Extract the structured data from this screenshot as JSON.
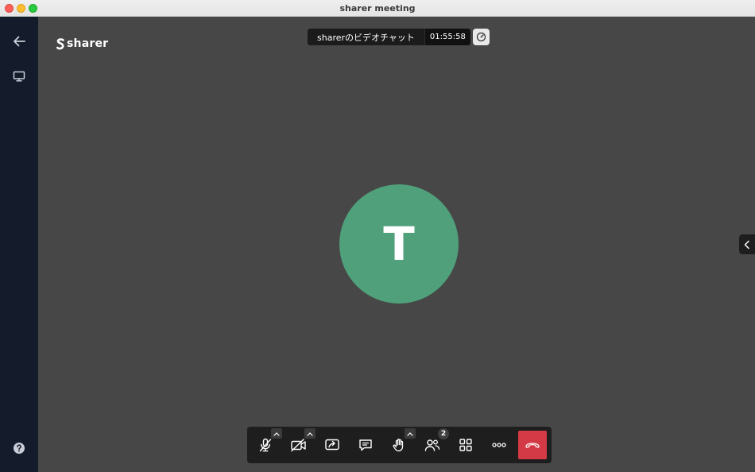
{
  "window": {
    "title": "sharer meeting"
  },
  "sidebar": {
    "items": [
      {
        "name": "back",
        "icon": "arrow-left-icon"
      },
      {
        "name": "screen",
        "icon": "monitor-icon"
      },
      {
        "name": "help",
        "icon": "help-circle-icon"
      }
    ]
  },
  "brand": {
    "logo_text": "sharer",
    "logo_icon": "sharer-s-logo-icon"
  },
  "meeting": {
    "name": "sharerのビデオチャット",
    "elapsed": "01:55:58"
  },
  "participant": {
    "initial": "T",
    "avatar_color": "#4fa07b"
  },
  "toolbar": {
    "participants_count": "2",
    "buttons": [
      {
        "name": "mute",
        "icon": "microphone-off-icon"
      },
      {
        "name": "camera",
        "icon": "camera-off-icon"
      },
      {
        "name": "share-screen",
        "icon": "share-screen-icon"
      },
      {
        "name": "chat",
        "icon": "chat-icon"
      },
      {
        "name": "raise-hand",
        "icon": "hand-icon"
      },
      {
        "name": "participants",
        "icon": "participants-icon"
      },
      {
        "name": "layout",
        "icon": "grid-icon"
      },
      {
        "name": "more",
        "icon": "more-dots-icon"
      },
      {
        "name": "leave",
        "icon": "phone-hangup-icon"
      }
    ]
  },
  "colors": {
    "sidebar_bg": "#141c2b",
    "stage_bg": "#474747",
    "end_call": "#d43a45",
    "toolbar_bg": "#1e1e1e"
  }
}
